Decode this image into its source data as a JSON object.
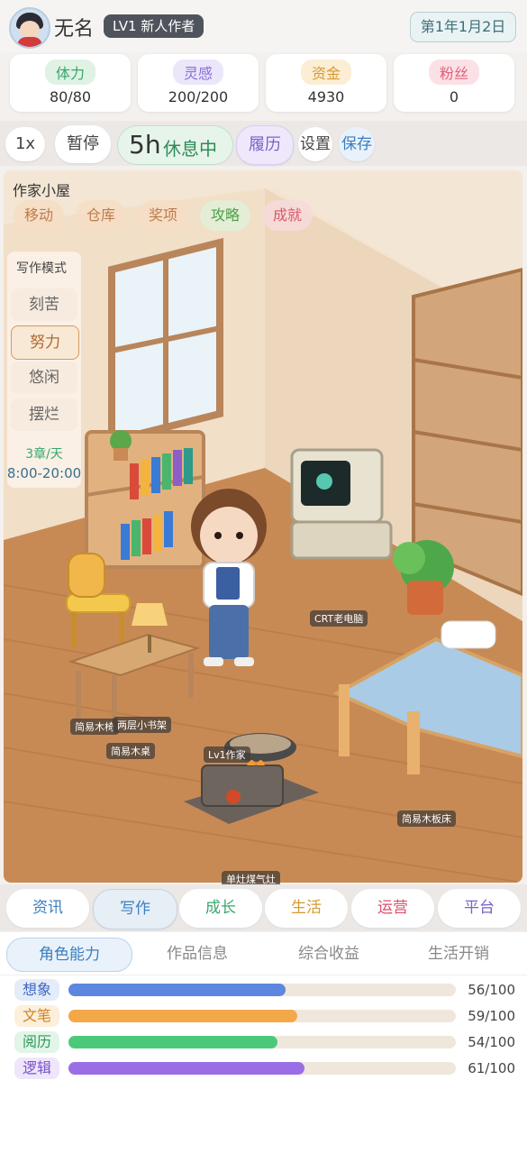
{
  "header": {
    "name": "无名",
    "level_badge": "LV1 新人作者",
    "date": "第1年1月2日"
  },
  "stats": [
    {
      "label": "体力",
      "value": "80/80",
      "color": "#3aa76d",
      "bg": "#dff2e4"
    },
    {
      "label": "灵感",
      "value": "200/200",
      "color": "#8b6fd6",
      "bg": "#ece6fb"
    },
    {
      "label": "资金",
      "value": "4930",
      "color": "#d79a32",
      "bg": "#fbeed5"
    },
    {
      "label": "粉丝",
      "value": "0",
      "color": "#e0607a",
      "bg": "#fbe1e6"
    }
  ],
  "controls": {
    "speed": "1x",
    "pause": "暂停",
    "hours": "5h",
    "status": "休息中",
    "resume": "履历",
    "settings": "设置",
    "save": "保存"
  },
  "scene": {
    "title": "作家小屋",
    "tabs": [
      "移动",
      "仓库",
      "奖项",
      "攻略",
      "成就"
    ],
    "mode_title": "写作模式",
    "modes": [
      "刻苦",
      "努力",
      "悠闲",
      "摆烂"
    ],
    "selected_mode": "努力",
    "chapters": "3章/天",
    "hours_range": "8:00-20:00",
    "labels": {
      "computer": "CRT老电脑",
      "chair": "简易木椅",
      "shelf": "两层小书架",
      "desk": "简易木桌",
      "player": "Lv1作家",
      "stove": "单灶煤气灶",
      "bed": "简易木板床"
    }
  },
  "nav": [
    {
      "label": "资讯",
      "color": "#3b7fbf"
    },
    {
      "label": "写作",
      "color": "#3b7fbf"
    },
    {
      "label": "成长",
      "color": "#3aa76d"
    },
    {
      "label": "生活",
      "color": "#d79a32"
    },
    {
      "label": "运营",
      "color": "#d9516b"
    },
    {
      "label": "平台",
      "color": "#7a62c9"
    }
  ],
  "subtabs": [
    "角色能力",
    "作品信息",
    "综合收益",
    "生活开销"
  ],
  "abilities": [
    {
      "label": "想象",
      "value": "56/100",
      "fraction": 0.56,
      "color": "#5d86e0",
      "bg": "#e4ecfa",
      "text": "#3e66c2"
    },
    {
      "label": "文笔",
      "value": "59/100",
      "fraction": 0.59,
      "color": "#f4a848",
      "bg": "#fcefdc",
      "text": "#d08322"
    },
    {
      "label": "阅历",
      "value": "54/100",
      "fraction": 0.54,
      "color": "#4bc97a",
      "bg": "#e1f5e8",
      "text": "#2e9a57"
    },
    {
      "label": "逻辑",
      "value": "61/100",
      "fraction": 0.61,
      "color": "#9a6fe6",
      "bg": "#eee6fb",
      "text": "#7a52c8"
    }
  ]
}
